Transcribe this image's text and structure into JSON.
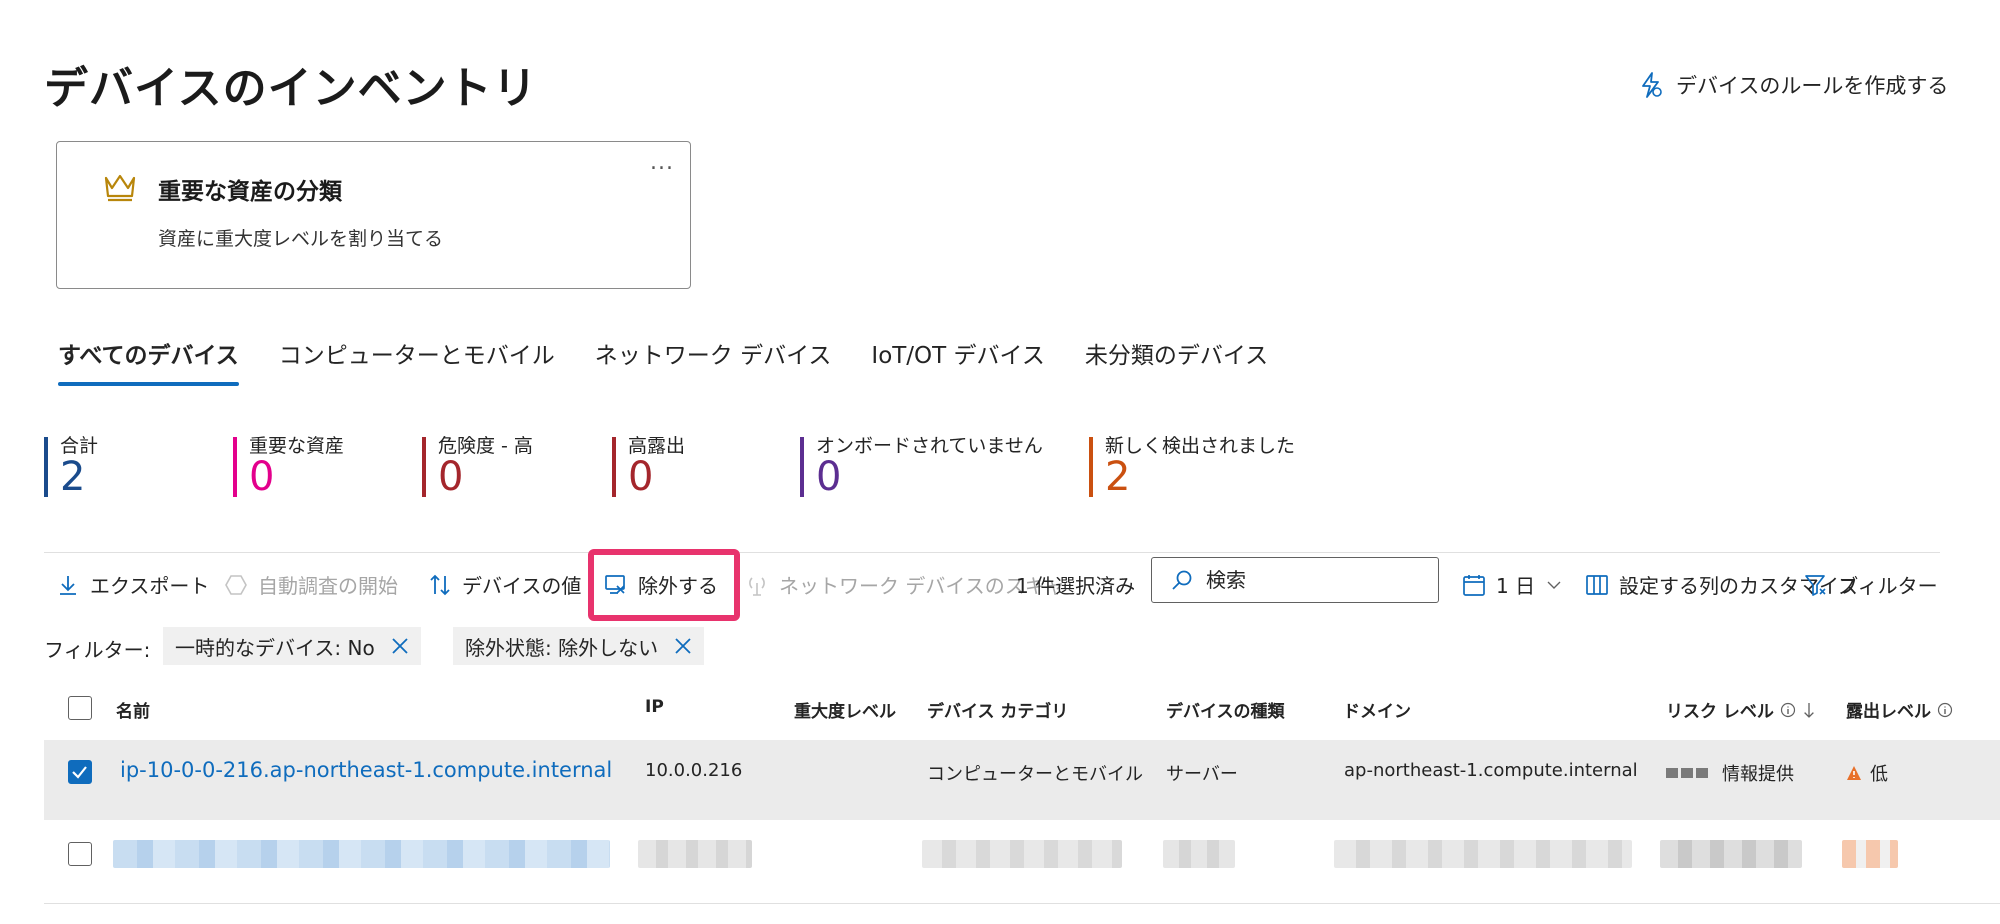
{
  "page": {
    "title": "デバイスのインベントリ",
    "create_rule": "デバイスのルールを作成する"
  },
  "card": {
    "more": "...",
    "title": "重要な資産の分類",
    "description": "資産に重大度レベルを割り当てる"
  },
  "tabs": [
    {
      "label": "すべてのデバイス",
      "active": true
    },
    {
      "label": "コンピューターとモバイル"
    },
    {
      "label": "ネットワーク デバイス"
    },
    {
      "label": "IoT/OT デバイス"
    },
    {
      "label": "未分類のデバイス"
    }
  ],
  "stats": [
    {
      "label": "合計",
      "value": "2",
      "color": "#1a4b8c"
    },
    {
      "label": "重要な資産",
      "value": "0",
      "color": "#e3008c"
    },
    {
      "label": "危険度 - 高",
      "value": "0",
      "color": "#a4262c"
    },
    {
      "label": "高露出",
      "value": "0",
      "color": "#a4262c"
    },
    {
      "label": "オンボードされていません",
      "value": "0",
      "color": "#5c2e91"
    },
    {
      "label": "新しく検出されました",
      "value": "2",
      "color": "#ca5010"
    }
  ],
  "toolbar": {
    "export": "エクスポート",
    "auto_investigate": "自動調査の開始",
    "device_value": "デバイスの値",
    "exclude": "除外する",
    "network_scan": "ネットワーク デバイスのスキャ",
    "selected_count": "1 件選択済み",
    "search_placeholder": "検索",
    "period": "1 日",
    "customize": "設定する列のカスタマイズ",
    "filter": "フィルター"
  },
  "filters": {
    "label": "フィルター:",
    "chips": [
      {
        "text": "一時的なデバイス: No"
      },
      {
        "text": "除外状態: 除外しない"
      }
    ]
  },
  "table": {
    "headers": {
      "name": "名前",
      "ip": "IP",
      "criticality": "重大度レベル",
      "category": "デバイス カテゴリ",
      "type": "デバイスの種類",
      "domain": "ドメイン",
      "risk": "リスク レベル",
      "exposure": "露出レベル"
    },
    "rows": [
      {
        "selected": true,
        "name": "ip-10-0-0-216.ap-northeast-1.compute.internal",
        "ip": "10.0.0.216",
        "criticality": "",
        "category": "コンピューターとモバイル",
        "type": "サーバー",
        "domain": "ap-northeast-1.compute.internal",
        "risk": "情報提供",
        "exposure": "低"
      }
    ]
  },
  "colors": {
    "accent": "#0f6cbd",
    "highlight": "#e8336d",
    "warning": "#e8702a"
  }
}
